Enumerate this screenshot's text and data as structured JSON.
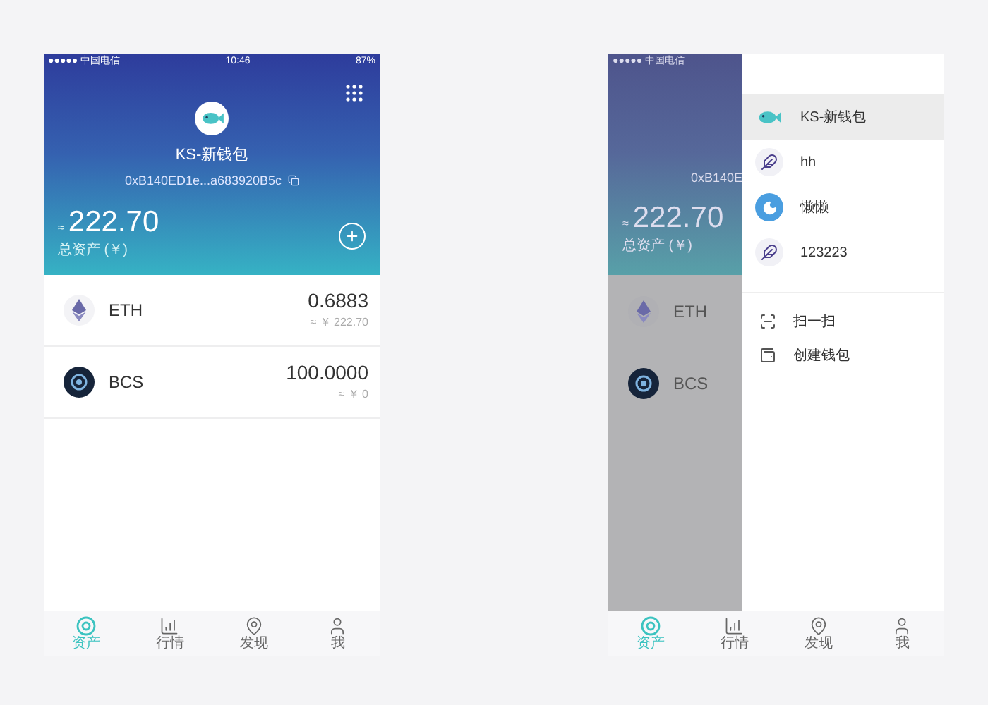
{
  "left_screen": {
    "status_bar": {
      "carrier": "●●●●● 中国电信",
      "time": "10:46",
      "battery": "87%"
    },
    "header": {
      "wallet_name": "KS-新钱包",
      "address": "0xB140ED1e...a683920B5c",
      "total_prefix": "≈",
      "total": "222.70",
      "total_label": "总资产 (￥)"
    },
    "assets": [
      {
        "kind": "eth",
        "symbol": "ETH",
        "amount": "0.6883",
        "value": "≈ ￥ 222.70"
      },
      {
        "kind": "bcs",
        "symbol": "BCS",
        "amount": "100.0000",
        "value": "≈ ￥ 0"
      }
    ],
    "tab_bar": [
      {
        "kind": "assets",
        "label": "资产",
        "selected": true
      },
      {
        "kind": "market",
        "label": "行情",
        "selected": false
      },
      {
        "kind": "discover",
        "label": "发现",
        "selected": false
      },
      {
        "kind": "me",
        "label": "我",
        "selected": false
      }
    ]
  },
  "right_screen": {
    "status_bar": {
      "carrier": "●●●●● 中国电信"
    },
    "background": {
      "address": "0xB140E",
      "total_prefix": "≈",
      "total": "222.70",
      "total_label": "总资产 (￥)",
      "assets": [
        {
          "kind": "eth",
          "symbol": "ETH"
        },
        {
          "kind": "bcs",
          "symbol": "BCS"
        }
      ]
    },
    "drawer": {
      "wallets": [
        {
          "kind": "fish",
          "name": "KS-新钱包",
          "selected": true
        },
        {
          "kind": "feather",
          "name": "hh",
          "selected": false
        },
        {
          "kind": "moon",
          "name": "懒懒",
          "selected": false
        },
        {
          "kind": "feather",
          "name": "123223",
          "selected": false
        }
      ],
      "actions": [
        {
          "kind": "scan",
          "label": "扫一扫"
        },
        {
          "kind": "wallet",
          "label": "创建钱包"
        }
      ]
    },
    "tab_bar": [
      {
        "kind": "assets",
        "label": "资产",
        "selected": true
      },
      {
        "kind": "market",
        "label": "行情",
        "selected": false
      },
      {
        "kind": "discover",
        "label": "发现",
        "selected": false
      },
      {
        "kind": "me",
        "label": "我",
        "selected": false
      }
    ]
  }
}
